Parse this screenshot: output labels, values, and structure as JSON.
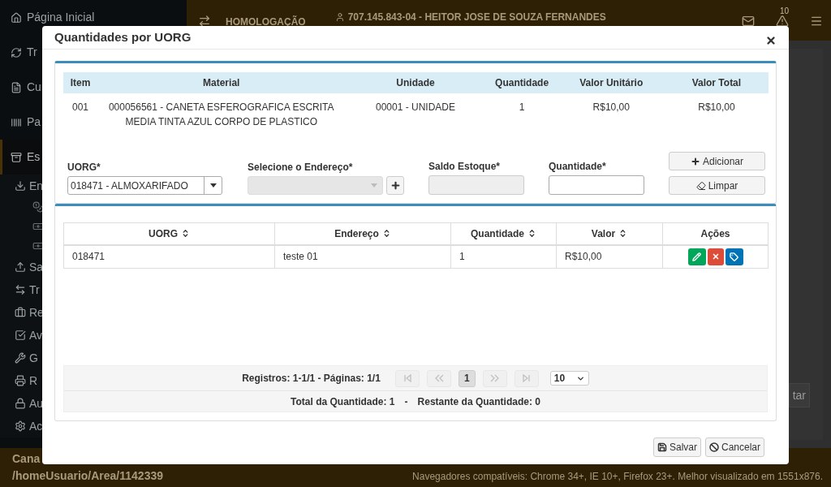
{
  "header": {
    "environment": "HOMOLOGAÇÃO",
    "user": "707.145.843-04 - HEITOR JOSE DE SOUZA FERNANDES",
    "alert_count": "10"
  },
  "sidebar": {
    "items": [
      {
        "label": "Página Inicial",
        "selected": false
      },
      {
        "label": "Tr",
        "selected": false
      },
      {
        "label": "Cu",
        "selected": false
      },
      {
        "label": "Pa",
        "selected": false
      },
      {
        "label": "Es",
        "selected": true,
        "children": [
          {
            "label": "En",
            "children": [
              {
                "kind": "icon-only"
              },
              {
                "kind": "icon-only"
              },
              {
                "kind": "icon-only"
              }
            ]
          },
          {
            "label": "Sa"
          },
          {
            "label": "Tr"
          },
          {
            "label": "Re"
          },
          {
            "label": "Av"
          },
          {
            "label": "G"
          },
          {
            "label": "R"
          },
          {
            "label": "Au"
          },
          {
            "label": "Ac"
          }
        ]
      }
    ]
  },
  "background_button": "tar",
  "footer": {
    "title": "Cana",
    "path": "/homeUsuario/Area/1142339",
    "browsers": "Navegadores compatíveis: Chrome 34+, IE 10+, Firefox 23+. Melhor visualizado em 1551x876."
  },
  "modal": {
    "title": "Quantidades por UORG",
    "material_table": {
      "columns": [
        "Item",
        "Material",
        "Unidade",
        "Quantidade",
        "Valor Unitário",
        "Valor Total"
      ],
      "rows": [
        [
          "001",
          "000056561 - CANETA ESFEROGRAFICA ESCRITA MEDIA TINTA AZUL CORPO DE PLASTICO",
          "00001 - UNIDADE",
          "1",
          "R$10,00",
          "R$10,00"
        ]
      ]
    },
    "form": {
      "uorg": {
        "label": "UORG*",
        "value": "018471 - ALMOXARIFADO"
      },
      "endereco": {
        "label": "Selecione o Endereço*",
        "disabled": true
      },
      "saldo": {
        "label": "Saldo Estoque*",
        "disabled": true
      },
      "quantidade": {
        "label": "Quantidade*"
      },
      "buttons": [
        "Adicionar",
        "Limpar"
      ]
    },
    "uorg_table": {
      "columns": [
        "UORG",
        "Endereço",
        "Quantidade",
        "Valor",
        "Ações"
      ],
      "rows": [
        [
          "018471",
          "teste 01",
          "1",
          "R$10,00"
        ]
      ]
    },
    "pagination": {
      "summary": "Registros: 1-1/1 - Páginas: 1/1",
      "nav": [
        {
          "kind": "first",
          "disabled": true
        },
        {
          "kind": "prev",
          "disabled": true
        },
        {
          "kind": "page",
          "label": "1",
          "selected": true
        },
        {
          "kind": "next",
          "disabled": true
        },
        {
          "kind": "last",
          "disabled": true
        }
      ],
      "page_size": "10"
    },
    "totals": {
      "total": "Total da Quantidade: 1",
      "separator": "-",
      "remaining": "Restante da Quantidade: 0"
    },
    "buttons": [
      "Salvar",
      "Cancelar"
    ]
  }
}
